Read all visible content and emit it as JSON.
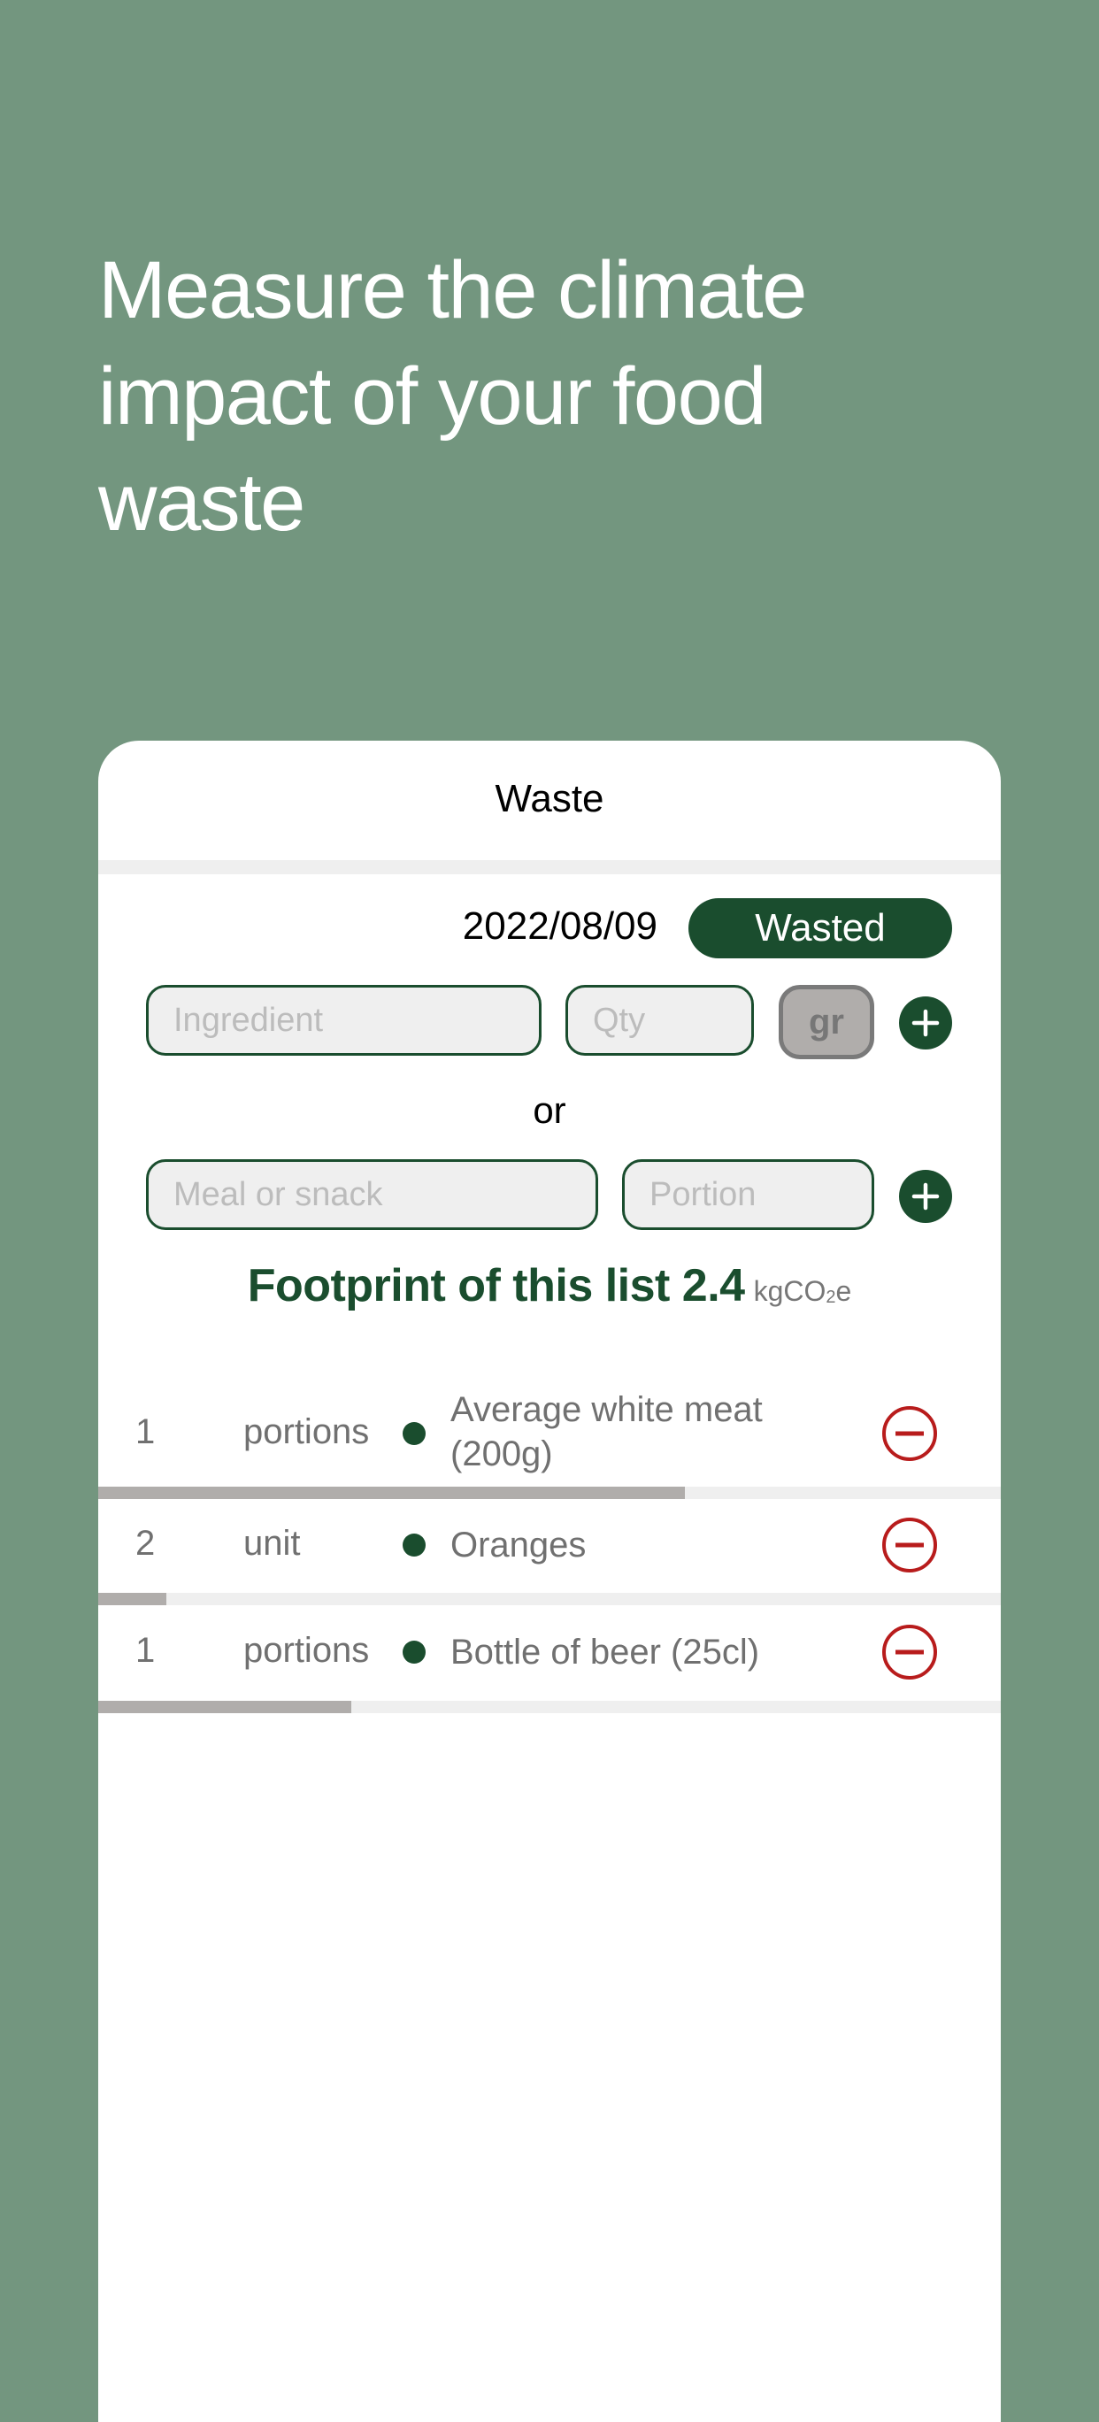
{
  "headline": "Measure the climate impact of your food waste",
  "colors": {
    "background": "#73967f",
    "brand_green": "#1a4d2e",
    "remove_red": "#b81c1c",
    "bar_fill": "#b0adab",
    "bar_track": "#efefef"
  },
  "card": {
    "title": "Waste",
    "date": "2022/08/09",
    "mode_button": "Wasted",
    "ingredient_form": {
      "ingredient_placeholder": "Ingredient",
      "ingredient_value": "",
      "qty_placeholder": "Qty",
      "qty_value": "",
      "unit_button": "gr",
      "add_icon": "plus-circle-icon"
    },
    "separator": "or",
    "meal_form": {
      "meal_placeholder": "Meal or snack",
      "meal_value": "",
      "portion_placeholder": "Portion",
      "portion_value": "",
      "add_icon": "plus-circle-icon"
    },
    "footprint": {
      "label": "Footprint of this list",
      "value": "2.4",
      "unit_prefix": "kgCO",
      "unit_sub": "2",
      "unit_suffix": "e"
    },
    "items": [
      {
        "qty": "1",
        "unit": "portions",
        "name": "Average white meat (200g)",
        "impact_fraction": 0.65,
        "remove_icon": "minus-circle-icon"
      },
      {
        "qty": "2",
        "unit": "unit",
        "name": "Oranges",
        "impact_fraction": 0.075,
        "remove_icon": "minus-circle-icon"
      },
      {
        "qty": "1",
        "unit": "portions",
        "name": "Bottle of beer (25cl)",
        "impact_fraction": 0.28,
        "remove_icon": "minus-circle-icon"
      }
    ]
  }
}
